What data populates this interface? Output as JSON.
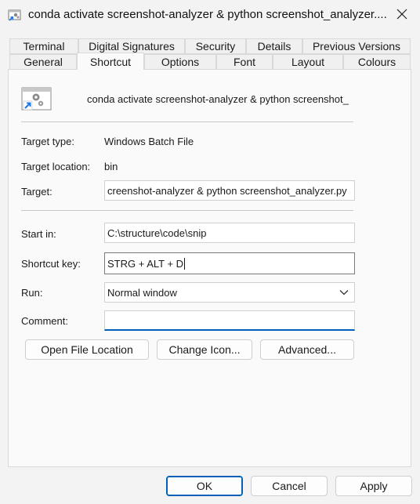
{
  "window": {
    "title": "conda activate screenshot-analyzer & python screenshot_analyzer...."
  },
  "tabs_row1": [
    {
      "label": "Terminal"
    },
    {
      "label": "Digital Signatures"
    },
    {
      "label": "Security"
    },
    {
      "label": "Details"
    },
    {
      "label": "Previous Versions"
    }
  ],
  "tabs_row2": [
    {
      "label": "General"
    },
    {
      "label": "Shortcut",
      "active": true
    },
    {
      "label": "Options"
    },
    {
      "label": "Font"
    },
    {
      "label": "Layout"
    },
    {
      "label": "Colours"
    }
  ],
  "shortcut": {
    "name": "conda activate screenshot-analyzer & python screenshot_",
    "target_type_label": "Target type:",
    "target_type": "Windows Batch File",
    "target_location_label": "Target location:",
    "target_location": "bin",
    "target_label": "Target:",
    "target": "creenshot-analyzer & python screenshot_analyzer.py",
    "start_in_label": "Start in:",
    "start_in": "C:\\structure\\code\\snip",
    "shortcut_key_label": "Shortcut key:",
    "shortcut_key": "STRG + ALT + D",
    "run_label": "Run:",
    "run": "Normal window",
    "comment_label": "Comment:",
    "comment": ""
  },
  "buttons": {
    "open_file_location": "Open File Location",
    "change_icon": "Change Icon...",
    "advanced": "Advanced..."
  },
  "footer": {
    "ok": "OK",
    "cancel": "Cancel",
    "apply": "Apply"
  },
  "colors": {
    "accent": "#005fb8",
    "window_bg": "#f3f3f3",
    "panel_bg": "#fafafa"
  },
  "icons": {
    "title": "batch-file-shortcut-icon",
    "file": "gear-window-shortcut-icon",
    "close": "close-icon",
    "dropdown": "chevron-down-icon"
  }
}
